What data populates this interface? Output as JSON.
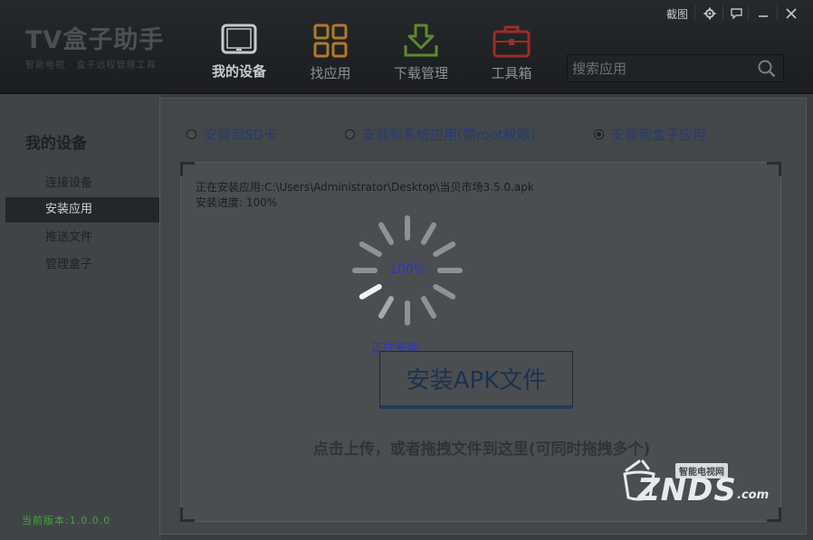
{
  "app": {
    "logo_title": "TV盒子助手",
    "logo_subtitle": "智能电视 · 盒子远程管理工具"
  },
  "window_controls": {
    "screenshot_label": "截图"
  },
  "nav": [
    {
      "label": "我的设备",
      "icon": "tablet-icon",
      "active": true
    },
    {
      "label": "找应用",
      "icon": "app-grid-icon",
      "active": false
    },
    {
      "label": "下载管理",
      "icon": "download-icon",
      "active": false
    },
    {
      "label": "工具箱",
      "icon": "toolbox-icon",
      "active": false
    }
  ],
  "search": {
    "placeholder": "搜索应用"
  },
  "sidebar": {
    "title": "我的设备",
    "items": [
      {
        "label": "连接设备",
        "active": false
      },
      {
        "label": "安装应用",
        "active": true
      },
      {
        "label": "推送文件",
        "active": false
      },
      {
        "label": "管理盒子",
        "active": false
      }
    ],
    "version": "当前版本:1.0.0.0"
  },
  "install_options": [
    {
      "label": "安装到SD卡",
      "checked": false
    },
    {
      "label": "安装到系统应用(需root权限)",
      "checked": false
    },
    {
      "label": "安装到盒子应用",
      "checked": true
    }
  ],
  "install": {
    "path_line": "正在安装应用:C:\\Users\\Administrator\\Desktop\\当贝市场3.5.0.apk",
    "progress_line": "安装进度:  100%",
    "progress_value": 100,
    "progress_text": "100%",
    "status_text": "正在安装...",
    "button_label": "安装APK文件",
    "hint": "点击上传，或者拖拽文件到这里(可同时拖拽多个)"
  },
  "watermark": {
    "brand": "ZNDS",
    "suffix": ".com",
    "badge": "智能电视网"
  },
  "colors": {
    "accent_blue": "#2a35c4",
    "version_green": "#49a244",
    "radio_text": "#233b73"
  }
}
